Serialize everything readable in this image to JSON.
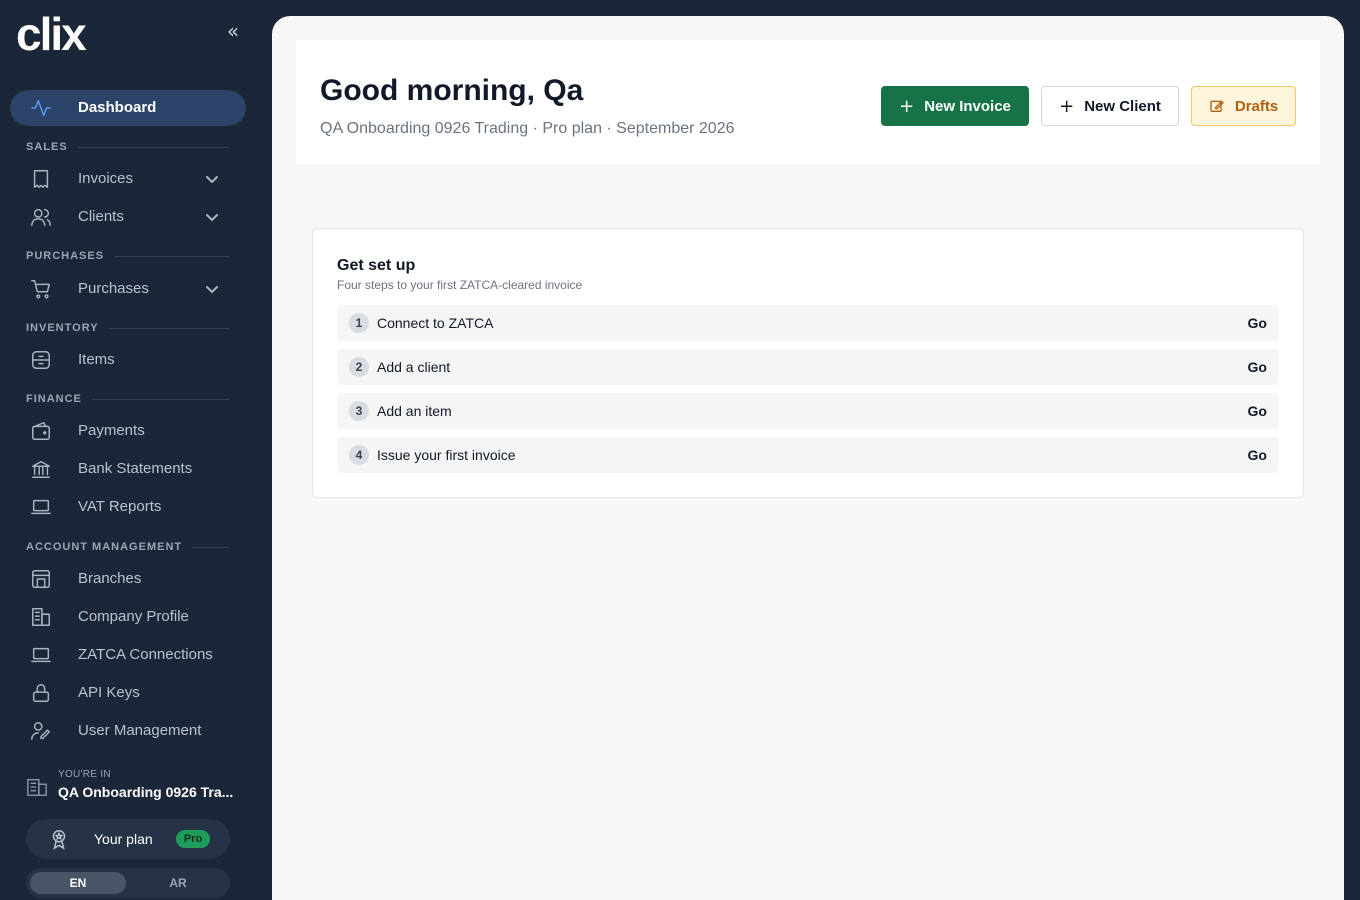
{
  "sidebar": {
    "logo_text": "clix",
    "collapse_icon": "double-chevron-left-icon",
    "dashboard": {
      "label": "Dashboard",
      "icon": "activity-icon",
      "active": true
    },
    "sections": {
      "sales": "SALES",
      "purchases": "PURCHASES",
      "inventory": "INVENTORY",
      "finance": "FINANCE",
      "account": "ACCOUNT MANAGEMENT"
    },
    "items": {
      "invoices": {
        "label": "Invoices",
        "icon": "receipt-icon"
      },
      "clients": {
        "label": "Clients",
        "icon": "users-icon"
      },
      "purchases": {
        "label": "Purchases",
        "icon": "cart-icon"
      },
      "items": {
        "label": "Items",
        "icon": "box-icon"
      },
      "payments": {
        "label": "Payments",
        "icon": "wallet-icon"
      },
      "bank_statements": {
        "label": "Bank Statements",
        "icon": "bank-icon"
      },
      "vat_reports": {
        "label": "VAT Reports",
        "icon": "laptop-icon"
      },
      "branches": {
        "label": "Branches",
        "icon": "store-icon"
      },
      "company_profile": {
        "label": "Company Profile",
        "icon": "building-icon"
      },
      "zatca_connections": {
        "label": "ZATCA Connections",
        "icon": "laptop-icon"
      },
      "api_keys": {
        "label": "API Keys",
        "icon": "lock-icon"
      },
      "user_management": {
        "label": "User Management",
        "icon": "user-edit-icon"
      }
    },
    "context": {
      "caption": "YOU'RE IN",
      "org": "QA Onboarding 0926 Tra..."
    },
    "plan": {
      "label": "Your plan",
      "badge": "Pro"
    },
    "language": {
      "en": "EN",
      "ar": "AR",
      "selected": "EN"
    }
  },
  "header": {
    "greeting": "Good morning, Qa",
    "subline": "QA Onboarding 0926 Trading · Pro plan · September 2026",
    "new_invoice": "New Invoice",
    "new_client": "New Client",
    "drafts": "Drafts",
    "colors": {
      "primary": "#157347",
      "drafts_bg": "#fdf6dc",
      "drafts_text": "#b45f0c"
    }
  },
  "setup": {
    "title": "Get set up",
    "subtitle": "Four steps to your first ZATCA-cleared invoice",
    "steps": [
      {
        "num": "1",
        "label": "Connect to ZATCA",
        "action": "Go"
      },
      {
        "num": "2",
        "label": "Add a client",
        "action": "Go"
      },
      {
        "num": "3",
        "label": "Add an item",
        "action": "Go"
      },
      {
        "num": "4",
        "label": "Issue your first invoice",
        "action": "Go"
      }
    ]
  }
}
